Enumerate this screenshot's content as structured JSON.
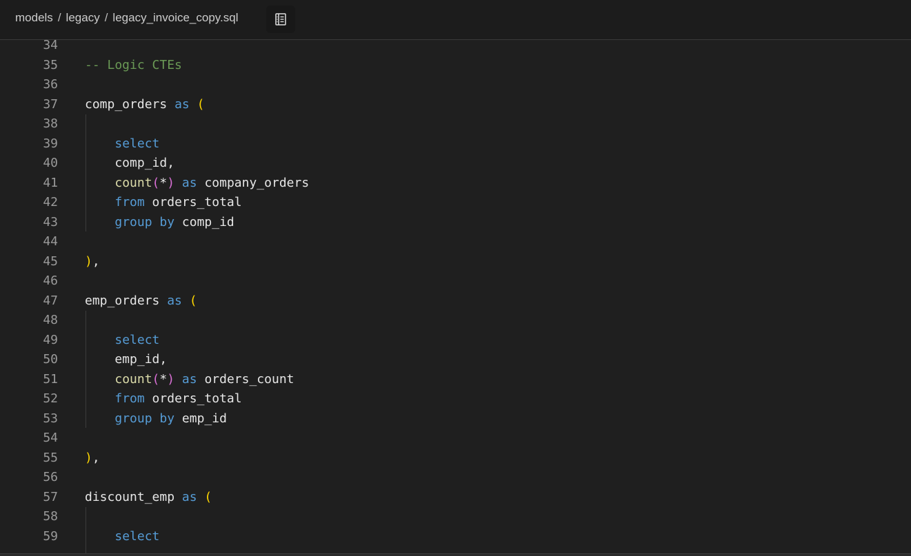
{
  "breadcrumb": {
    "items": [
      "models",
      "legacy",
      "legacy_invoice_copy.sql"
    ],
    "separator": "/"
  },
  "toolbar": {
    "outline_icon": "outline-list-icon"
  },
  "colors": {
    "background": "#1f1f1f",
    "header": "#1c1c1c",
    "line_number": "#9a9a9a",
    "identifier": "#e6e6e6",
    "keyword": "#569cd6",
    "function": "#dcdcaa",
    "bracket": "#ffd700",
    "star_paren": "#da70d6",
    "comment": "#6a9955"
  },
  "editor": {
    "lines": [
      {
        "num": "34",
        "tokens": []
      },
      {
        "num": "35",
        "tokens": [
          {
            "t": "-- Logic CTEs",
            "c": "cmt"
          }
        ]
      },
      {
        "num": "36",
        "tokens": []
      },
      {
        "num": "37",
        "tokens": [
          {
            "t": "comp_orders",
            "c": "id"
          },
          {
            "t": " ",
            "c": "id"
          },
          {
            "t": "as",
            "c": "kw"
          },
          {
            "t": " ",
            "c": "id"
          },
          {
            "t": "(",
            "c": "br"
          }
        ]
      },
      {
        "num": "38",
        "tokens": []
      },
      {
        "num": "39",
        "tokens": [
          {
            "t": "    ",
            "c": "id"
          },
          {
            "t": "select",
            "c": "kw"
          }
        ]
      },
      {
        "num": "40",
        "tokens": [
          {
            "t": "    comp_id,",
            "c": "id"
          }
        ]
      },
      {
        "num": "41",
        "tokens": [
          {
            "t": "    ",
            "c": "id"
          },
          {
            "t": "count",
            "c": "fn"
          },
          {
            "t": "(",
            "c": "pp"
          },
          {
            "t": "*",
            "c": "id"
          },
          {
            "t": ")",
            "c": "pp"
          },
          {
            "t": " ",
            "c": "id"
          },
          {
            "t": "as",
            "c": "kw"
          },
          {
            "t": " company_orders",
            "c": "id"
          }
        ]
      },
      {
        "num": "42",
        "tokens": [
          {
            "t": "    ",
            "c": "id"
          },
          {
            "t": "from",
            "c": "kw"
          },
          {
            "t": " orders_total",
            "c": "id"
          }
        ]
      },
      {
        "num": "43",
        "tokens": [
          {
            "t": "    ",
            "c": "id"
          },
          {
            "t": "group by",
            "c": "kw"
          },
          {
            "t": " comp_id",
            "c": "id"
          }
        ]
      },
      {
        "num": "44",
        "tokens": []
      },
      {
        "num": "45",
        "tokens": [
          {
            "t": ")",
            "c": "br"
          },
          {
            "t": ",",
            "c": "id"
          }
        ]
      },
      {
        "num": "46",
        "tokens": []
      },
      {
        "num": "47",
        "tokens": [
          {
            "t": "emp_orders",
            "c": "id"
          },
          {
            "t": " ",
            "c": "id"
          },
          {
            "t": "as",
            "c": "kw"
          },
          {
            "t": " ",
            "c": "id"
          },
          {
            "t": "(",
            "c": "br"
          }
        ]
      },
      {
        "num": "48",
        "tokens": []
      },
      {
        "num": "49",
        "tokens": [
          {
            "t": "    ",
            "c": "id"
          },
          {
            "t": "select",
            "c": "kw"
          }
        ]
      },
      {
        "num": "50",
        "tokens": [
          {
            "t": "    emp_id,",
            "c": "id"
          }
        ]
      },
      {
        "num": "51",
        "tokens": [
          {
            "t": "    ",
            "c": "id"
          },
          {
            "t": "count",
            "c": "fn"
          },
          {
            "t": "(",
            "c": "pp"
          },
          {
            "t": "*",
            "c": "id"
          },
          {
            "t": ")",
            "c": "pp"
          },
          {
            "t": " ",
            "c": "id"
          },
          {
            "t": "as",
            "c": "kw"
          },
          {
            "t": " orders_count",
            "c": "id"
          }
        ]
      },
      {
        "num": "52",
        "tokens": [
          {
            "t": "    ",
            "c": "id"
          },
          {
            "t": "from",
            "c": "kw"
          },
          {
            "t": " orders_total",
            "c": "id"
          }
        ]
      },
      {
        "num": "53",
        "tokens": [
          {
            "t": "    ",
            "c": "id"
          },
          {
            "t": "group by",
            "c": "kw"
          },
          {
            "t": " emp_id",
            "c": "id"
          }
        ]
      },
      {
        "num": "54",
        "tokens": []
      },
      {
        "num": "55",
        "tokens": [
          {
            "t": ")",
            "c": "br"
          },
          {
            "t": ",",
            "c": "id"
          }
        ]
      },
      {
        "num": "56",
        "tokens": []
      },
      {
        "num": "57",
        "tokens": [
          {
            "t": "discount_emp",
            "c": "id"
          },
          {
            "t": " ",
            "c": "id"
          },
          {
            "t": "as",
            "c": "kw"
          },
          {
            "t": " ",
            "c": "id"
          },
          {
            "t": "(",
            "c": "br"
          }
        ]
      },
      {
        "num": "58",
        "tokens": []
      },
      {
        "num": "59",
        "tokens": [
          {
            "t": "    ",
            "c": "id"
          },
          {
            "t": "select",
            "c": "kw"
          }
        ]
      }
    ]
  }
}
